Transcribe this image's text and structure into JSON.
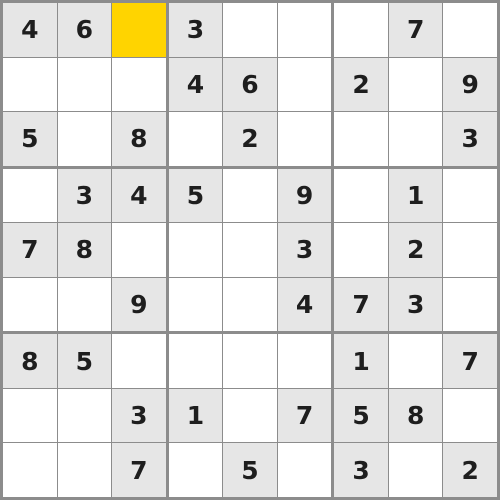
{
  "puzzle": {
    "rows": [
      [
        "4",
        "6",
        "",
        "3",
        "",
        "",
        "",
        "7",
        ""
      ],
      [
        "",
        "",
        "",
        "4",
        "6",
        "",
        "2",
        "",
        "9"
      ],
      [
        "5",
        "",
        "8",
        "",
        "2",
        "",
        "",
        "",
        "3"
      ],
      [
        "",
        "3",
        "4",
        "5",
        "",
        "9",
        "",
        "1",
        ""
      ],
      [
        "7",
        "8",
        "",
        "",
        "",
        "3",
        "",
        "2",
        ""
      ],
      [
        "",
        "",
        "9",
        "",
        "",
        "4",
        "7",
        "3",
        ""
      ],
      [
        "8",
        "5",
        "",
        "",
        "",
        "",
        "1",
        "",
        "7"
      ],
      [
        "",
        "",
        "3",
        "1",
        "",
        "7",
        "5",
        "8",
        ""
      ],
      [
        "",
        "",
        "7",
        "",
        "5",
        "",
        "3",
        "",
        "2"
      ]
    ],
    "selected": {
      "row": 0,
      "col": 2
    }
  },
  "colors": {
    "given_cell_bg": "#e6e6e6",
    "empty_cell_bg": "#ffffff",
    "selected_cell_bg": "#ffd400",
    "digit_color": "#1e1e1e",
    "grid_line": "#8c8c8c"
  }
}
